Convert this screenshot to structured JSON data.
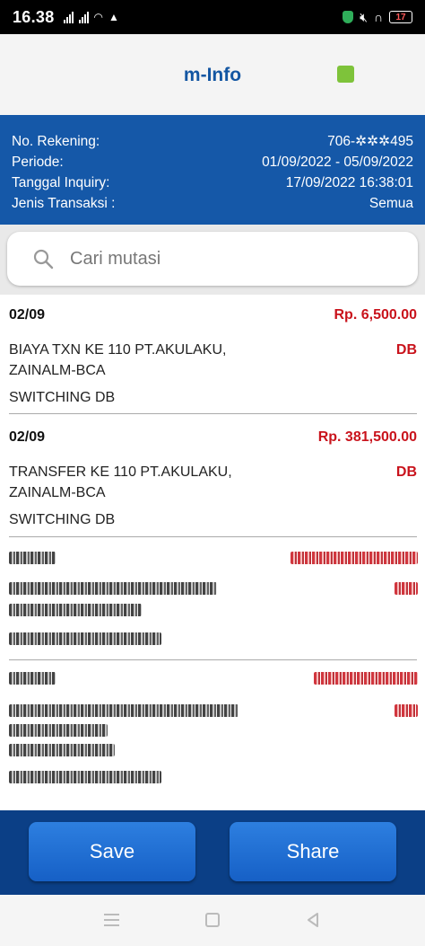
{
  "status_bar": {
    "time": "16.38",
    "battery": "17"
  },
  "app": {
    "title": "m-Info",
    "status_color": "#7ec33a"
  },
  "info": {
    "rows": [
      {
        "label": "No. Rekening:",
        "value": "706-✲✲✲495"
      },
      {
        "label": "Periode:",
        "value": "01/09/2022 - 05/09/2022"
      },
      {
        "label": "Tanggal Inquiry:",
        "value": "17/09/2022 16:38:01"
      },
      {
        "label": "Jenis Transaksi :",
        "value": "Semua"
      }
    ]
  },
  "search": {
    "placeholder": "Cari mutasi",
    "icon": "search-icon"
  },
  "transactions": [
    {
      "date": "02/09",
      "amount": "Rp. 6,500.00",
      "description_line1": "BIAYA TXN  KE 110 PT.AKULAKU,",
      "description_line2": "ZAINALM-BCA",
      "type": "DB",
      "channel": "SWITCHING DB"
    },
    {
      "date": "02/09",
      "amount": "Rp. 381,500.00",
      "description_line1": "TRANSFER   KE 110 PT.AKULAKU,",
      "description_line2": "ZAINALM-BCA",
      "type": "DB",
      "channel": "SWITCHING DB"
    }
  ],
  "buttons": {
    "save": "Save",
    "share": "Share"
  },
  "colors": {
    "header_blue": "#1558a8",
    "button_bar": "#0b3f86",
    "amount_red": "#c9131c",
    "title_blue": "#1356a2"
  }
}
